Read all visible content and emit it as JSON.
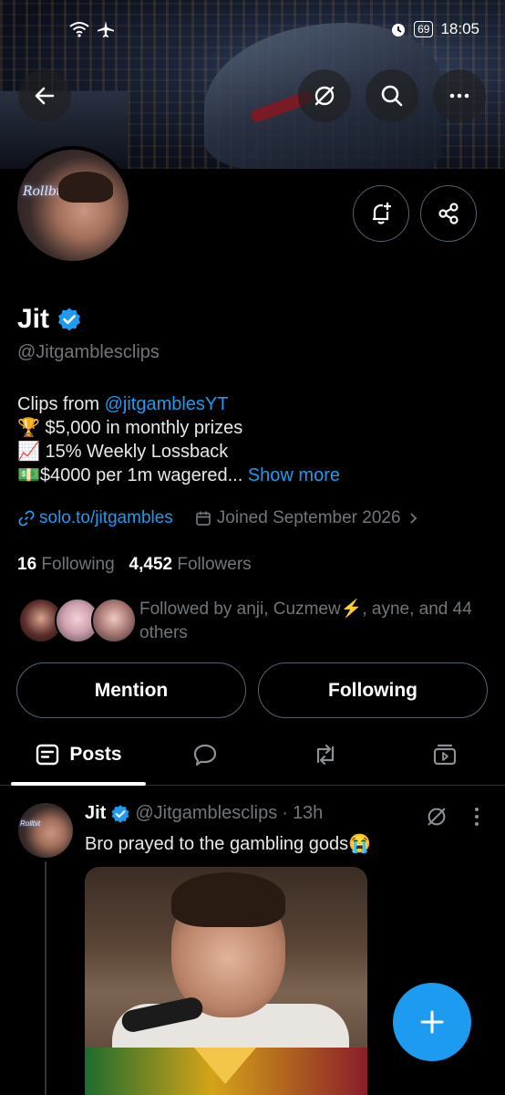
{
  "status_bar": {
    "time": "18:05",
    "battery": "69"
  },
  "profile": {
    "name": "Jit",
    "handle": "@Jitgamblesclips",
    "avatar_neon_text": "Rollbit",
    "bio": {
      "line1_prefix": "Clips from ",
      "line1_mention": "@jitgamblesYT",
      "line2": "🏆 $5,000 in monthly prizes",
      "line3": "📈 15% Weekly Lossback",
      "line4": "💵$4000 per 1m wagered...",
      "show_more": "Show more"
    },
    "link": "solo.to/jitgambles",
    "joined": "Joined September 2026",
    "following_count": "16",
    "following_label": "Following",
    "followers_count": "4,452",
    "followers_label": "Followers",
    "followed_by": "Followed by anji, Cuzmew⚡, ayne, and 44 others"
  },
  "buttons": {
    "mention": "Mention",
    "following": "Following"
  },
  "tabs": {
    "posts": "Posts"
  },
  "post": {
    "name": "Jit",
    "handle": "@Jitgamblesclips",
    "separator": "·",
    "time": "13h",
    "text": "Bro prayed to the gambling gods😭"
  },
  "colors": {
    "accent": "#1d9bf0",
    "background": "#000000",
    "muted": "#71767b"
  },
  "icons": [
    "back-arrow-icon",
    "no-show-icon",
    "search-icon",
    "more-icon",
    "notification-add-icon",
    "share-icon",
    "verified-badge-icon",
    "link-icon",
    "calendar-icon",
    "chevron-right-icon",
    "posts-tab-icon",
    "replies-tab-icon",
    "repost-tab-icon",
    "media-tab-icon",
    "compose-plus-icon"
  ]
}
